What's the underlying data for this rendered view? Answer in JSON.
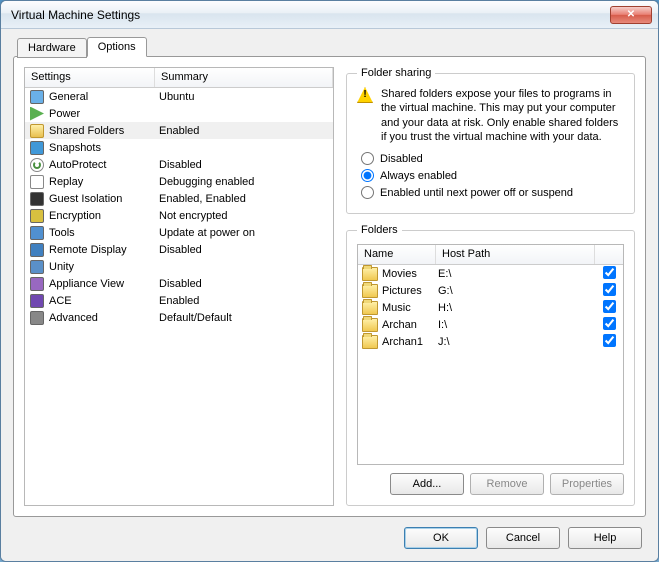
{
  "window": {
    "title": "Virtual Machine Settings"
  },
  "tabs": {
    "hardware": "Hardware",
    "options": "Options",
    "active": "options"
  },
  "settings_header": {
    "col1": "Settings",
    "col2": "Summary"
  },
  "settings": [
    {
      "key": "general",
      "label": "General",
      "summary": "Ubuntu",
      "icon": "ico-general"
    },
    {
      "key": "power",
      "label": "Power",
      "summary": "",
      "icon": "ico-power"
    },
    {
      "key": "shared-folders",
      "label": "Shared Folders",
      "summary": "Enabled",
      "icon": "ico-shared",
      "selected": true
    },
    {
      "key": "snapshots",
      "label": "Snapshots",
      "summary": "",
      "icon": "ico-snap"
    },
    {
      "key": "autoprotect",
      "label": "AutoProtect",
      "summary": "Disabled",
      "icon": "ico-auto"
    },
    {
      "key": "replay",
      "label": "Replay",
      "summary": "Debugging enabled",
      "icon": "ico-replay"
    },
    {
      "key": "guest-isolation",
      "label": "Guest Isolation",
      "summary": "Enabled, Enabled",
      "icon": "ico-guest"
    },
    {
      "key": "encryption",
      "label": "Encryption",
      "summary": "Not encrypted",
      "icon": "ico-encrypt"
    },
    {
      "key": "tools",
      "label": "Tools",
      "summary": "Update at power on",
      "icon": "ico-tools"
    },
    {
      "key": "remote-display",
      "label": "Remote Display",
      "summary": "Disabled",
      "icon": "ico-remote"
    },
    {
      "key": "unity",
      "label": "Unity",
      "summary": "",
      "icon": "ico-unity"
    },
    {
      "key": "appliance-view",
      "label": "Appliance View",
      "summary": "Disabled",
      "icon": "ico-appview"
    },
    {
      "key": "ace",
      "label": "ACE",
      "summary": "Enabled",
      "icon": "ico-ace"
    },
    {
      "key": "advanced",
      "label": "Advanced",
      "summary": "Default/Default",
      "icon": "ico-adv"
    }
  ],
  "sharing": {
    "legend": "Folder sharing",
    "warning": "Shared folders expose your files to programs in the virtual machine. This may put your computer and your data at risk. Only enable shared folders if you trust the virtual machine with your data.",
    "radios": {
      "disabled": "Disabled",
      "always": "Always enabled",
      "until": "Enabled until next power off or suspend"
    },
    "selected": "always"
  },
  "folders": {
    "legend": "Folders",
    "header": {
      "name": "Name",
      "path": "Host Path"
    },
    "rows": [
      {
        "name": "Movies",
        "path": "E:\\",
        "checked": true
      },
      {
        "name": "Pictures",
        "path": "G:\\",
        "checked": true
      },
      {
        "name": "Music",
        "path": "H:\\",
        "checked": true
      },
      {
        "name": "Archan",
        "path": "I:\\",
        "checked": true
      },
      {
        "name": "Archan1",
        "path": "J:\\",
        "checked": true
      }
    ],
    "buttons": {
      "add": "Add...",
      "remove": "Remove",
      "properties": "Properties"
    }
  },
  "buttons": {
    "ok": "OK",
    "cancel": "Cancel",
    "help": "Help"
  }
}
